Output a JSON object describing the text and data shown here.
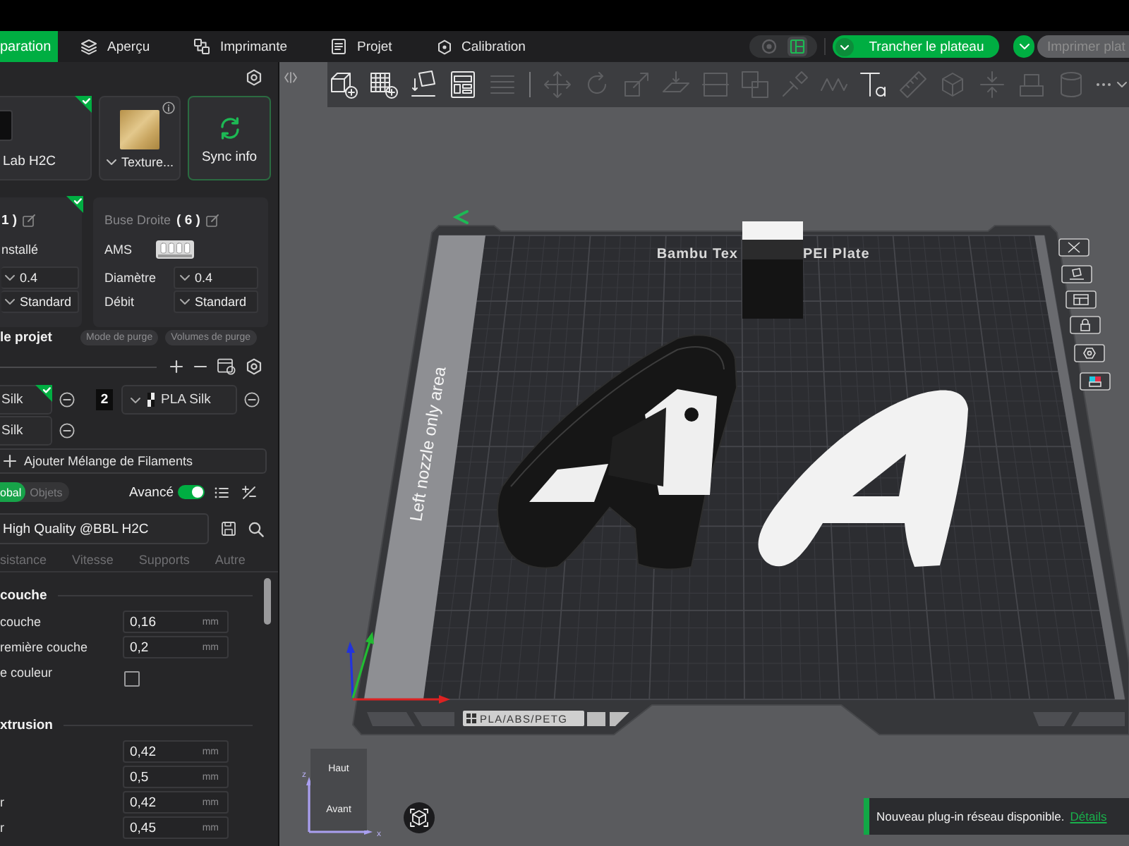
{
  "top_bar": {
    "tabs": [
      {
        "kind": "prepare",
        "label": "paration",
        "selected": true
      },
      {
        "kind": "preview",
        "label": "Aperçu",
        "selected": false
      },
      {
        "kind": "device",
        "label": "Imprimante",
        "selected": false
      },
      {
        "kind": "project",
        "label": "Projet",
        "selected": false
      },
      {
        "kind": "calibration",
        "label": "Calibration",
        "selected": false
      }
    ],
    "view_switch": [
      {
        "kind": "assembly",
        "selected": false
      },
      {
        "kind": "layout",
        "selected": true
      }
    ],
    "slice_button": {
      "label": "Trancher le plateau",
      "disabled": false
    },
    "print_button": {
      "label": "Imprimer plat",
      "disabled": true
    }
  },
  "sidebar": {
    "printer_cards": [
      {
        "kind": "printer",
        "label": "Lab H2C",
        "synced": true
      },
      {
        "kind": "plate",
        "label": "Texture...",
        "synced": false
      },
      {
        "kind": "sync",
        "label": "Sync info",
        "synced": false
      }
    ],
    "nozzles": [
      {
        "count": "1 )",
        "synced": true,
        "rows": [
          {
            "kind": "status",
            "value": "nstallé"
          },
          {
            "kind": "select",
            "value": "0.4"
          },
          {
            "kind": "select",
            "value": "Standard"
          }
        ]
      },
      {
        "name": "Buse Droite",
        "count": "( 6 )",
        "synced": false,
        "rows": [
          {
            "kind": "ams",
            "label": "AMS"
          },
          {
            "kind": "select",
            "label": "Diamètre",
            "value": "0.4"
          },
          {
            "kind": "select",
            "label": "Débit",
            "value": "Standard"
          }
        ]
      }
    ],
    "filament_header": {
      "title": "le projet",
      "buttons": [
        "Mode de purge",
        "Volumes de purge"
      ]
    },
    "filaments": [
      {
        "name": "Silk",
        "synced": true
      },
      {
        "number": "2",
        "name": "PLA Silk",
        "synced": false
      },
      {
        "name": "Silk",
        "synced": false
      }
    ],
    "add_mix_button": "Ajouter Mélange de Filaments",
    "scope_tabs": [
      {
        "label": "obal",
        "selected": true
      },
      {
        "label": "Objets",
        "selected": false
      }
    ],
    "advanced": {
      "label": "Avancé",
      "on": true
    },
    "preset": {
      "value": "High Quality @BBL H2C"
    },
    "setting_tabs": [
      {
        "label": "sistance",
        "selected": false
      },
      {
        "label": "Vitesse",
        "selected": false
      },
      {
        "label": "Supports",
        "selected": false
      },
      {
        "label": "Autre",
        "selected": false
      }
    ],
    "sections": [
      {
        "title": "couche",
        "rows": [
          {
            "kind": "number",
            "label": "couche",
            "value": "0,16",
            "unit": "mm"
          },
          {
            "kind": "number",
            "label": "remière couche",
            "value": "0,2",
            "unit": "mm"
          },
          {
            "kind": "checkbox",
            "label": "e couleur",
            "checked": false
          }
        ]
      },
      {
        "title": "xtrusion",
        "rows": [
          {
            "kind": "number",
            "value": "0,42",
            "unit": "mm"
          },
          {
            "kind": "number",
            "value": "0,5",
            "unit": "mm"
          },
          {
            "kind": "number",
            "label": "r",
            "value": "0,42",
            "unit": "mm"
          },
          {
            "kind": "number",
            "label": "r",
            "value": "0,45",
            "unit": "mm"
          }
        ]
      }
    ]
  },
  "viewport": {
    "toolbar": {
      "main": [
        {
          "kind": "cube",
          "disabled": false
        },
        {
          "kind": "grid",
          "disabled": false
        },
        {
          "kind": "orient",
          "disabled": false
        },
        {
          "kind": "arrange",
          "disabled": false
        },
        {
          "kind": "layers",
          "disabled": true
        }
      ],
      "tools": [
        {
          "kind": "move",
          "disabled": true
        },
        {
          "kind": "rotate",
          "disabled": true
        },
        {
          "kind": "scale",
          "disabled": true
        },
        {
          "kind": "lay",
          "disabled": true
        },
        {
          "kind": "cut",
          "disabled": true
        },
        {
          "kind": "boolean",
          "disabled": true
        },
        {
          "kind": "support",
          "disabled": true
        },
        {
          "kind": "seam",
          "disabled": true
        },
        {
          "kind": "text",
          "disabled": false
        },
        {
          "kind": "measure",
          "disabled": true
        },
        {
          "kind": "assembly",
          "disabled": true
        },
        {
          "kind": "split",
          "disabled": true
        },
        {
          "kind": "emboss",
          "disabled": true
        },
        {
          "kind": "drum",
          "disabled": true
        }
      ]
    },
    "plate": {
      "label_parts": [
        "Bambu Tex",
        "PEI Plate"
      ],
      "zone_label": "Left nozzle only area",
      "material_label": "PLA/ABS/PETG"
    },
    "view_cube": {
      "top": "Haut",
      "front": "Avant",
      "axis_labels": [
        "z",
        "x"
      ]
    },
    "notification": {
      "message": "Nouveau plug-in réseau disponible.",
      "link": "Détails"
    }
  }
}
